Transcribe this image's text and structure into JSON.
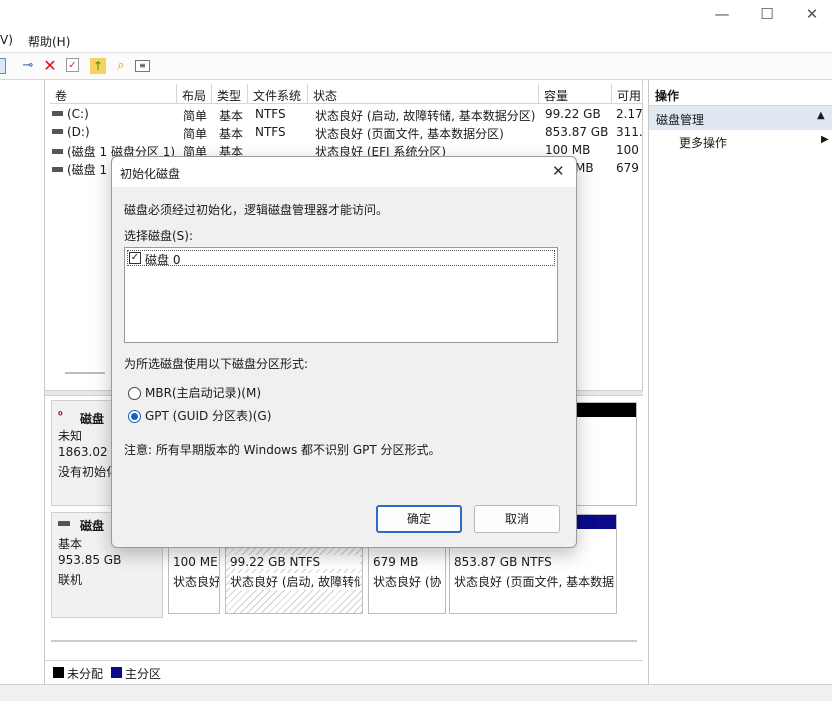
{
  "window": {
    "minimize": "—",
    "maximize": "☐",
    "close": "✕"
  },
  "menu": {
    "view_fragment": "V)",
    "help": "帮助(H)"
  },
  "volumes": {
    "columns": [
      "卷",
      "布局",
      "类型",
      "文件系统",
      "状态",
      "容量",
      "可用"
    ],
    "rows": [
      {
        "vol": "(C:)",
        "layout": "简单",
        "type": "基本",
        "fs": "NTFS",
        "status": "状态良好 (启动, 故障转储, 基本数据分区)",
        "cap": "99.22 GB",
        "free": "2.17"
      },
      {
        "vol": "(D:)",
        "layout": "简单",
        "type": "基本",
        "fs": "NTFS",
        "status": "状态良好 (页面文件, 基本数据分区)",
        "cap": "853.87 GB",
        "free": "311."
      },
      {
        "vol": "(磁盘 1 磁盘分区 1)",
        "layout": "简单",
        "type": "基本",
        "fs": "",
        "status": "状态良好 (EFI 系统分区)",
        "cap": "100 MB",
        "free": "100"
      },
      {
        "vol": "(磁盘 1",
        "layout": "",
        "type": "",
        "fs": "",
        "status": "",
        "cap": "MB",
        "free": "679"
      }
    ]
  },
  "actions": {
    "header": "操作",
    "section": "磁盘管理",
    "more": "更多操作"
  },
  "disk0": {
    "name": "磁盘",
    "type": "未知",
    "size": "1863.02 C",
    "state": "没有初始化"
  },
  "disk1": {
    "name": "磁盘",
    "type": "基本",
    "size": "953.85 GB",
    "state": "联机"
  },
  "partitions": [
    {
      "size": "100 ME",
      "status": "状态良好"
    },
    {
      "size": "99.22 GB NTFS",
      "status": "状态良好 (启动, 故障转储"
    },
    {
      "size": "679 MB",
      "status": "状态良好 (协"
    },
    {
      "size": "853.87 GB NTFS",
      "status": "状态良好 (页面文件, 基本数据"
    }
  ],
  "legend": {
    "unallocated": "未分配",
    "primary": "主分区"
  },
  "colors": {
    "primary_partition": "#0a0a8a",
    "unallocated": "#000000",
    "accent": "#1a5ec0"
  },
  "dialog": {
    "title": "初始化磁盘",
    "close": "✕",
    "intro": "磁盘必须经过初始化，逻辑磁盘管理器才能访问。",
    "select_label": "选择磁盘(S):",
    "disk_item": "磁盘 0",
    "disk_checked": true,
    "scheme_label": "为所选磁盘使用以下磁盘分区形式:",
    "mbr": "MBR(主启动记录)(M)",
    "gpt": "GPT (GUID 分区表)(G)",
    "selected_scheme": "GPT",
    "note": "注意: 所有早期版本的 Windows 都不识别 GPT 分区形式。",
    "ok": "确定",
    "cancel": "取消"
  }
}
